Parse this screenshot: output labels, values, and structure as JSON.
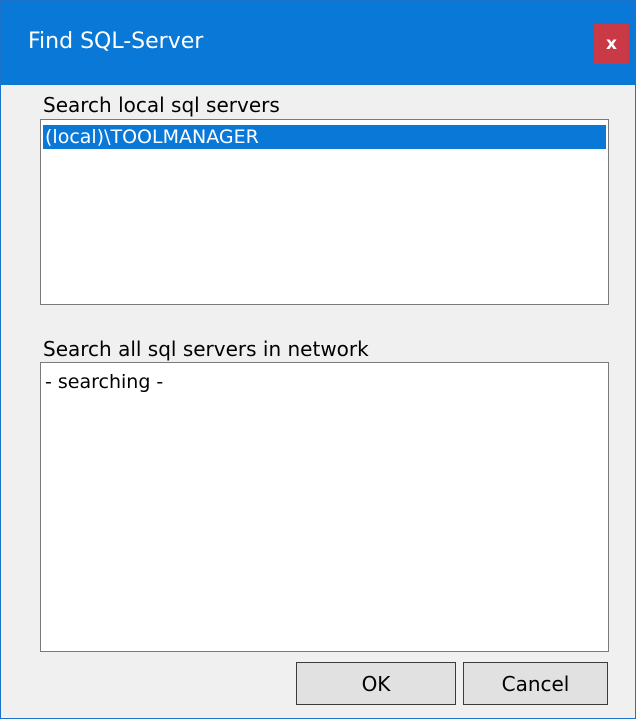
{
  "window": {
    "title": "Find SQL-Server",
    "close_label": "x"
  },
  "local": {
    "label": "Search local sql servers",
    "items": [
      "(local)\\TOOLMANAGER"
    ],
    "selected_index": 0
  },
  "network": {
    "label": "Search all sql servers in network",
    "items": [
      "- searching -"
    ]
  },
  "buttons": {
    "ok_label": "OK",
    "cancel_label": "Cancel"
  },
  "colors": {
    "titlebar": "#0a78d7",
    "close_button": "#c93a46",
    "selection": "#0a78d7",
    "window_background": "#f0f0f0"
  }
}
